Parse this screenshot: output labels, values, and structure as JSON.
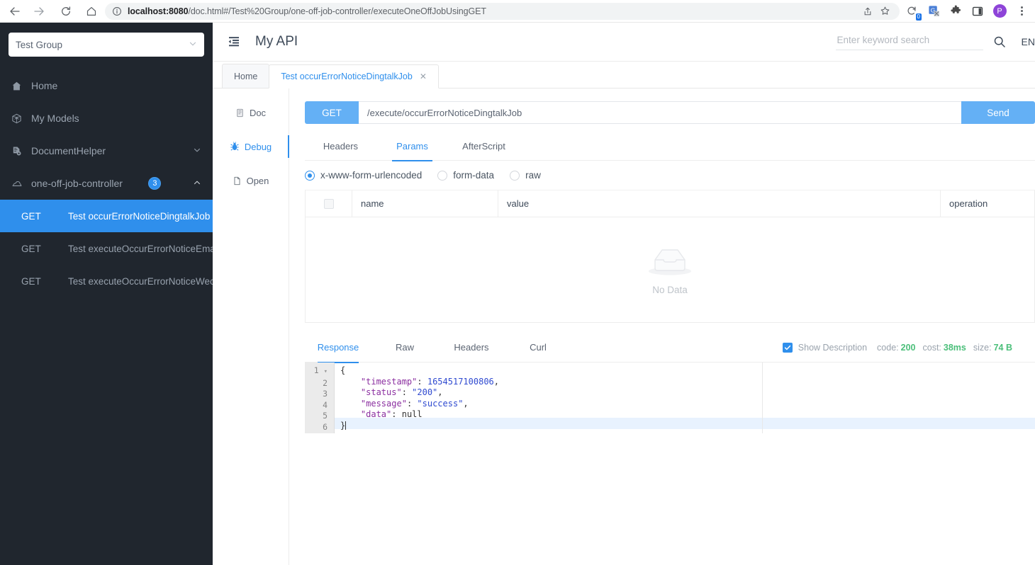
{
  "browser": {
    "url_host": "localhost:8080",
    "url_path": "/doc.html#/Test%20Group/one-off-job-controller/executeOneOffJobUsingGET",
    "back_icon": "back-arrow-icon",
    "forward_icon": "forward-arrow-icon",
    "reload_icon": "reload-icon",
    "home_icon": "home-icon",
    "info_icon": "site-info-icon",
    "share_icon": "share-icon",
    "bookmark_icon": "star-icon",
    "extension_badge": "0",
    "profile_initial": "P"
  },
  "sidebar": {
    "group_select": {
      "value": "Test Group",
      "caret": "chevron-down-icon"
    },
    "items": [
      {
        "label": "Home",
        "icon": "home-icon",
        "caret": "",
        "badge": ""
      },
      {
        "label": "My Models",
        "icon": "cube-icon",
        "caret": "",
        "badge": ""
      },
      {
        "label": "DocumentHelper",
        "icon": "document-gear-icon",
        "caret": "˅",
        "badge": ""
      },
      {
        "label": "one-off-job-controller",
        "icon": "cloud-icon",
        "caret": "˄",
        "badge": "3"
      }
    ],
    "apis": [
      {
        "method": "GET",
        "name": "Test occurErrorNoticeDingtalkJob",
        "active": true
      },
      {
        "method": "GET",
        "name": "Test executeOccurErrorNoticeEmailJob",
        "active": false
      },
      {
        "method": "GET",
        "name": "Test executeOccurErrorNoticeWechatJob",
        "active": false
      }
    ]
  },
  "topbar": {
    "fold_icon": "menu-fold-icon",
    "title": "My API",
    "search_placeholder": "Enter keyword search",
    "search_value": "",
    "search_icon": "search-icon",
    "language": "EN"
  },
  "tabs": [
    {
      "label": "Home",
      "closable": false,
      "active": false
    },
    {
      "label": "Test occurErrorNoticeDingtalkJob",
      "closable": true,
      "close_icon": "close-icon",
      "active": true
    }
  ],
  "minimenu": [
    {
      "label": "Doc",
      "icon": "document-icon",
      "active": false
    },
    {
      "label": "Debug",
      "icon": "bug-icon",
      "active": true
    },
    {
      "label": "Open",
      "icon": "file-icon",
      "active": false
    }
  ],
  "request": {
    "method": "GET",
    "url": "/execute/occurErrorNoticeDingtalkJob",
    "send_label": "Send",
    "param_tabs": [
      {
        "label": "Headers",
        "active": false
      },
      {
        "label": "Params",
        "active": true
      },
      {
        "label": "AfterScript",
        "active": false
      }
    ],
    "body_types": [
      {
        "label": "x-www-form-urlencoded",
        "checked": true
      },
      {
        "label": "form-data",
        "checked": false
      },
      {
        "label": "raw",
        "checked": false
      }
    ],
    "table": {
      "columns": [
        "name",
        "value",
        "operation"
      ],
      "rows": [],
      "empty_text": "No Data",
      "empty_icon": "empty-box-icon"
    }
  },
  "response": {
    "tabs": [
      {
        "label": "Response",
        "active": true
      },
      {
        "label": "Raw",
        "active": false
      },
      {
        "label": "Headers",
        "active": false
      },
      {
        "label": "Curl",
        "active": false
      }
    ],
    "show_description_label": "Show Description",
    "show_description_checked": true,
    "code_label": "code:",
    "code_value": "200",
    "cost_label": "cost:",
    "cost_value": "38ms",
    "size_label": "size:",
    "size_value": "74 B",
    "body_lines": [
      {
        "n": "1",
        "fold": "▾",
        "html": "{"
      },
      {
        "n": "2",
        "fold": "",
        "html": "    <k>\"timestamp\"</k>: <n>1654517100806</n>,"
      },
      {
        "n": "3",
        "fold": "",
        "html": "    <k>\"status\"</k>: <s>\"200\"</s>,"
      },
      {
        "n": "4",
        "fold": "",
        "html": "    <k>\"message\"</k>: <s>\"success\"</s>,"
      },
      {
        "n": "5",
        "fold": "",
        "html": "    <k>\"data\"</k>: <z>null</z>"
      },
      {
        "n": "6",
        "fold": "",
        "html": "}"
      }
    ]
  },
  "colors": {
    "accent": "#2f8fec",
    "sidebar_bg": "#20262e",
    "button_blue": "#64b0f5",
    "status_green": "#4bbf7a"
  }
}
